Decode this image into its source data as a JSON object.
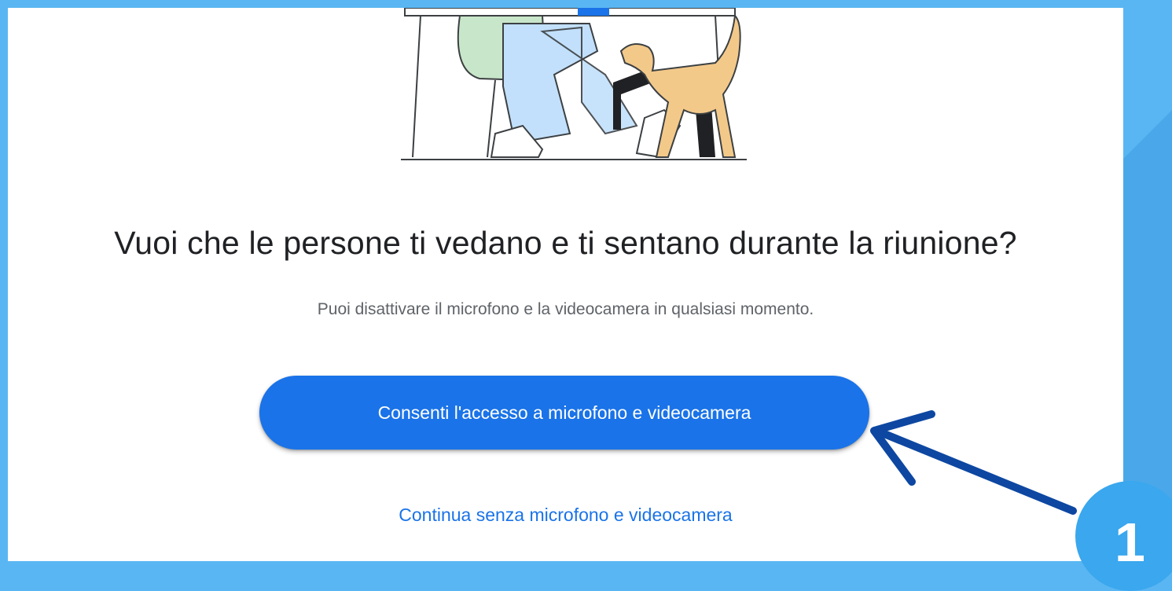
{
  "colors": {
    "frame": "#5ab6f2",
    "accent": "#1a73e8",
    "arrow": "#0d47a1",
    "badge": "#3aa7ee"
  },
  "illustration": {
    "icon": "person-at-desk-with-dog-illustration"
  },
  "prompt": {
    "title": "Vuoi che le persone ti vedano e ti sentano durante la riunione?",
    "subtitle": "Puoi disattivare il microfono e la videocamera in qualsiasi momento."
  },
  "actions": {
    "allow_label": "Consenti l'accesso a microfono e videocamera",
    "continue_label": "Continua senza microfono e videocamera"
  },
  "annotation": {
    "arrow_icon": "arrow-icon",
    "step_number": "1"
  }
}
